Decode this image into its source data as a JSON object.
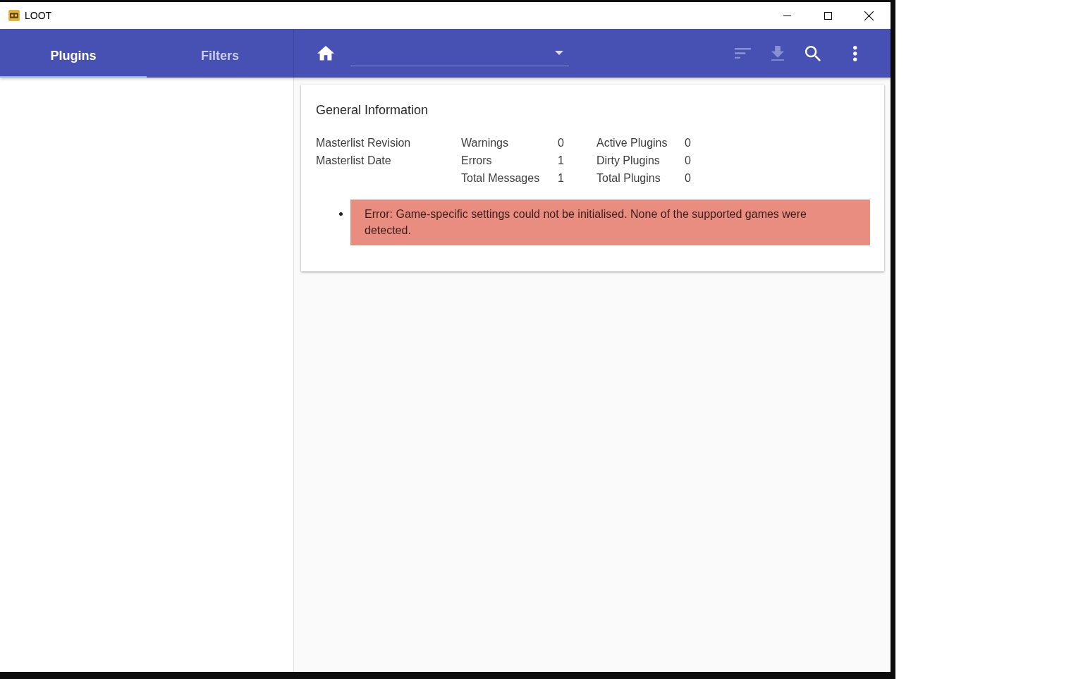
{
  "window": {
    "title": "LOOT"
  },
  "sidebar": {
    "tabs": [
      {
        "label": "Plugins",
        "selected": true
      },
      {
        "label": "Filters",
        "selected": false
      }
    ]
  },
  "toolbar": {
    "leading": [
      {
        "kind": "home",
        "disabled": false
      }
    ],
    "actions": [
      {
        "kind": "sort",
        "disabled": true
      },
      {
        "kind": "download",
        "disabled": true
      },
      {
        "kind": "search",
        "disabled": false
      },
      {
        "kind": "menu",
        "disabled": false
      }
    ]
  },
  "general_information": {
    "title": "General Information",
    "tables": [
      {
        "rows": [
          {
            "label": "Masterlist Revision"
          },
          {
            "label": "Masterlist Date"
          }
        ]
      },
      {
        "rows": [
          {
            "label": "Warnings",
            "value": "0"
          },
          {
            "label": "Errors",
            "value": "1"
          },
          {
            "label": "Total Messages",
            "value": "1"
          }
        ]
      },
      {
        "rows": [
          {
            "label": "Active Plugins",
            "value": "0"
          },
          {
            "label": "Dirty Plugins",
            "value": "0"
          },
          {
            "label": "Total Plugins",
            "value": "0"
          }
        ]
      }
    ],
    "messages": [
      {
        "kind": "error",
        "text": "Error: Game-specific settings could not be initialised. None of the supported games were detected."
      }
    ]
  }
}
